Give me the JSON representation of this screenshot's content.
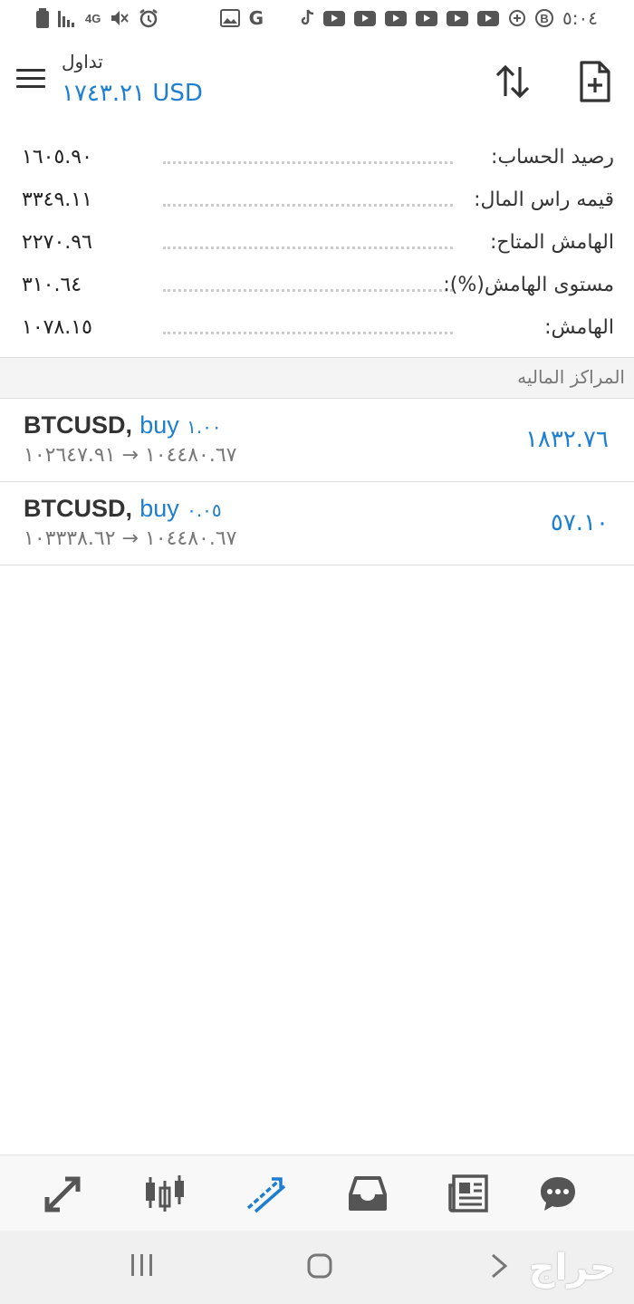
{
  "status_bar": {
    "network": "4G",
    "time": "٥:٠٤",
    "g_label": "G",
    "b_label": "B"
  },
  "header": {
    "title": "تداول",
    "balance": "١٧٤٣.٢١ USD"
  },
  "summary": [
    {
      "label": "رصيد الحساب:",
      "value": "١٦٠٥.٩٠"
    },
    {
      "label": "قيمه راس المال:",
      "value": "٣٣٤٩.١١"
    },
    {
      "label": "الهامش المتاح:",
      "value": "٢٢٧٠.٩٦"
    },
    {
      "label": "مستوى الهامش(%):",
      "value": "٣١٠.٦٤"
    },
    {
      "label": "الهامش:",
      "value": "١٠٧٨.١٥"
    }
  ],
  "section_title": "المراكز الماليه",
  "positions": [
    {
      "symbol": "BTCUSD,",
      "side": "buy",
      "volume": "١.٠٠",
      "prices": "١٠٤٤٨٠.٦٧ → ١٠٢٦٤٧.٩١",
      "profit": "١٨٣٢.٧٦"
    },
    {
      "symbol": "BTCUSD,",
      "side": "buy",
      "volume": "٠.٠٥",
      "prices": "١٠٤٤٨٠.٦٧ → ١٠٣٣٣٨.٦٢",
      "profit": "٥٧.١٠"
    }
  ],
  "bottom_nav": {
    "items": [
      "trade-arrows-icon",
      "candlestick-icon",
      "trade-chart-icon",
      "inbox-icon",
      "news-icon",
      "chat-icon"
    ],
    "active": "trade-chart-icon",
    "active_color": "#1e7fd1",
    "icon_color": "#555555"
  },
  "watermark": "حراج",
  "colors": {
    "accent": "#1e7fd1",
    "text": "#222222",
    "muted": "#777777"
  }
}
